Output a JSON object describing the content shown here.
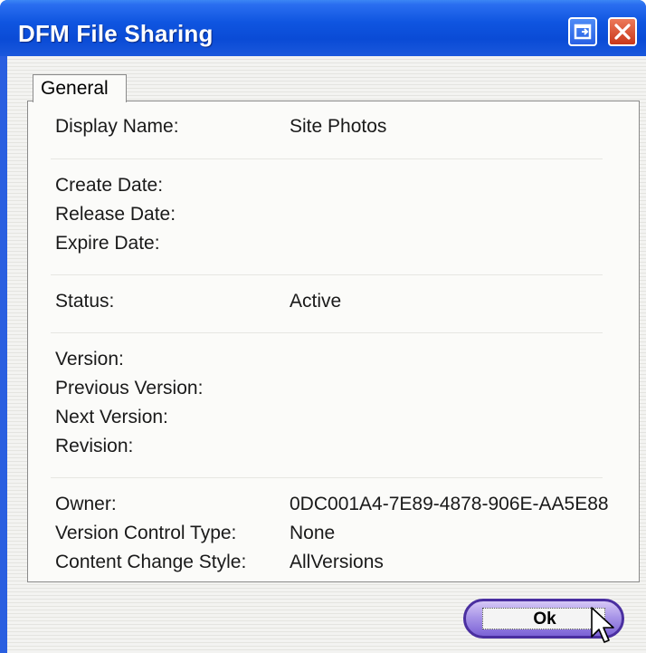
{
  "window": {
    "title": "DFM File Sharing",
    "controls": {
      "restore_icon": "restore-icon",
      "close_icon": "close-icon"
    }
  },
  "tabs": [
    {
      "label": "General",
      "selected": true
    }
  ],
  "general": {
    "display_name_label": "Display Name:",
    "display_name_value": "Site Photos",
    "create_date_label": "Create Date:",
    "release_date_label": "Release Date:",
    "expire_date_label": "Expire Date:",
    "status_label": "Status:",
    "status_value": "Active",
    "version_label": "Version:",
    "previous_version_label": "Previous Version:",
    "next_version_label": "Next Version:",
    "revision_label": "Revision:",
    "owner_label": "Owner:",
    "owner_value": "0DC001A4-7E89-4878-906E-AA5E88",
    "version_control_type_label": "Version Control Type:",
    "version_control_type_value": "None",
    "content_change_style_label": "Content Change Style:",
    "content_change_style_value": "AllVersions"
  },
  "buttons": {
    "ok_label": "Ok"
  },
  "colors": {
    "titlebar": "#0a4bd6",
    "frame": "#2a5fe0",
    "close_button": "#c9371a",
    "ok_button": "#7b62d6"
  }
}
